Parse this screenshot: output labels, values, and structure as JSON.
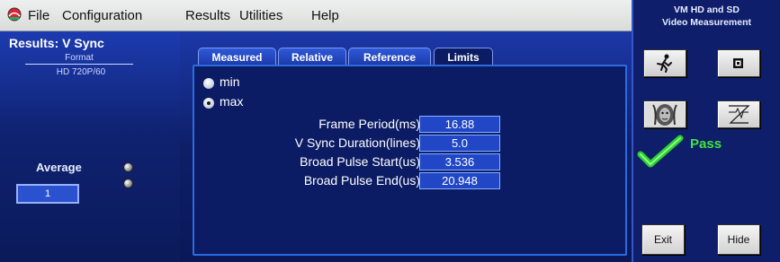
{
  "menu": {
    "items": [
      "File",
      "Configuration",
      "Results",
      "Utilities",
      "Help"
    ]
  },
  "left_panel": {
    "title": "Results: V Sync",
    "format_label": "Format",
    "format_value": "HD 720P/60",
    "average_label": "Average",
    "average_value": "1"
  },
  "tabs": [
    "Measured",
    "Relative",
    "Reference",
    "Limits"
  ],
  "active_tab": "Limits",
  "limit_options": [
    "min",
    "max"
  ],
  "selected_limit": "max",
  "rows": [
    {
      "label": "Frame Period(ms)",
      "value": "16.88"
    },
    {
      "label": "V Sync Duration(lines)",
      "value": "5.0"
    },
    {
      "label": "Broad Pulse Start(us)",
      "value": "3.536"
    },
    {
      "label": "Broad Pulse End(us)",
      "value": "20.948"
    }
  ],
  "right_panel": {
    "title_line1": "VM HD and SD",
    "title_line2": "Video Measurement",
    "status_text": "Pass",
    "exit_label": "Exit",
    "hide_label": "Hide"
  },
  "icons": [
    "app-logo-icon",
    "run-icon",
    "stop-icon",
    "picture-icon",
    "waveform-icon",
    "checkmark-icon"
  ],
  "colors": {
    "panel_bg": "#0f2270",
    "field_bg": "#2147c7",
    "pass_green": "#3fe43f"
  }
}
